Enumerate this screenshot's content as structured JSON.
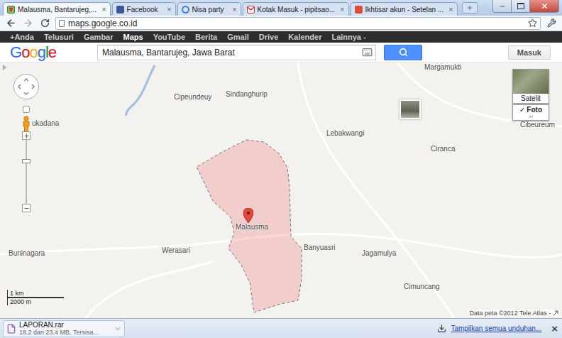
{
  "tabs": [
    {
      "title": "Malausma, Bantarujeg,...",
      "kind": "maps",
      "selected": true
    },
    {
      "title": "Facebook",
      "kind": "facebook",
      "selected": false
    },
    {
      "title": "Nisa party",
      "kind": "loading",
      "selected": false
    },
    {
      "title": "Kotak Masuk - pipitsao...",
      "kind": "gmail",
      "selected": false
    },
    {
      "title": "Ikhtisar akun - Setelan ...",
      "kind": "google",
      "selected": false
    }
  ],
  "tab_close": "×",
  "address_bar": {
    "url": "maps.google.co.id"
  },
  "google_bar": {
    "items": [
      {
        "label": "+Anda",
        "selected": false
      },
      {
        "label": "Telusuri",
        "selected": false
      },
      {
        "label": "Gambar",
        "selected": false
      },
      {
        "label": "Maps",
        "selected": true
      },
      {
        "label": "YouTube",
        "selected": false
      },
      {
        "label": "Berita",
        "selected": false
      },
      {
        "label": "Gmail",
        "selected": false
      },
      {
        "label": "Drive",
        "selected": false
      },
      {
        "label": "Kalender",
        "selected": false
      },
      {
        "label": "Lainnya -",
        "selected": false
      }
    ]
  },
  "header": {
    "logo": "Google",
    "search": {
      "value": "Malausma, Bantarujeg, Jawa Barat"
    },
    "sign_in": "Masuk"
  },
  "map": {
    "places": [
      {
        "name": "Margamukti",
        "pinned": false
      },
      {
        "name": "Cipeundeuy",
        "pinned": false
      },
      {
        "name": "Sindanghurip",
        "pinned": false
      },
      {
        "name": "ukadana",
        "pinned": false
      },
      {
        "name": "Cibeureum",
        "pinned": false
      },
      {
        "name": "Lebakwangi",
        "pinned": false
      },
      {
        "name": "Ciranca",
        "pinned": false
      },
      {
        "name": "Malausma",
        "pinned": true
      },
      {
        "name": "Werasari",
        "pinned": false
      },
      {
        "name": "Buninagara",
        "pinned": false
      },
      {
        "name": "Banyuasri",
        "pinned": false
      },
      {
        "name": "Jagamulya",
        "pinned": false
      },
      {
        "name": "Cimuncang",
        "pinned": false
      }
    ],
    "zoom": {
      "level": 0.68
    },
    "layers": {
      "satellite": "Satelit",
      "photos": {
        "label": "Foto",
        "checked": true,
        "mark": "✓"
      }
    },
    "scale": {
      "top": "1 km",
      "bottom": "2000 m"
    },
    "attribution": "Data peta ©2012 Tele Atlas -"
  },
  "downloads": {
    "items": [
      {
        "file": "LAPORAN.rar",
        "status": "18.2 dari 23.4 MB, Tersisa..."
      }
    ],
    "show_all": "Tampilkan semua unduhan...",
    "close": "×"
  }
}
